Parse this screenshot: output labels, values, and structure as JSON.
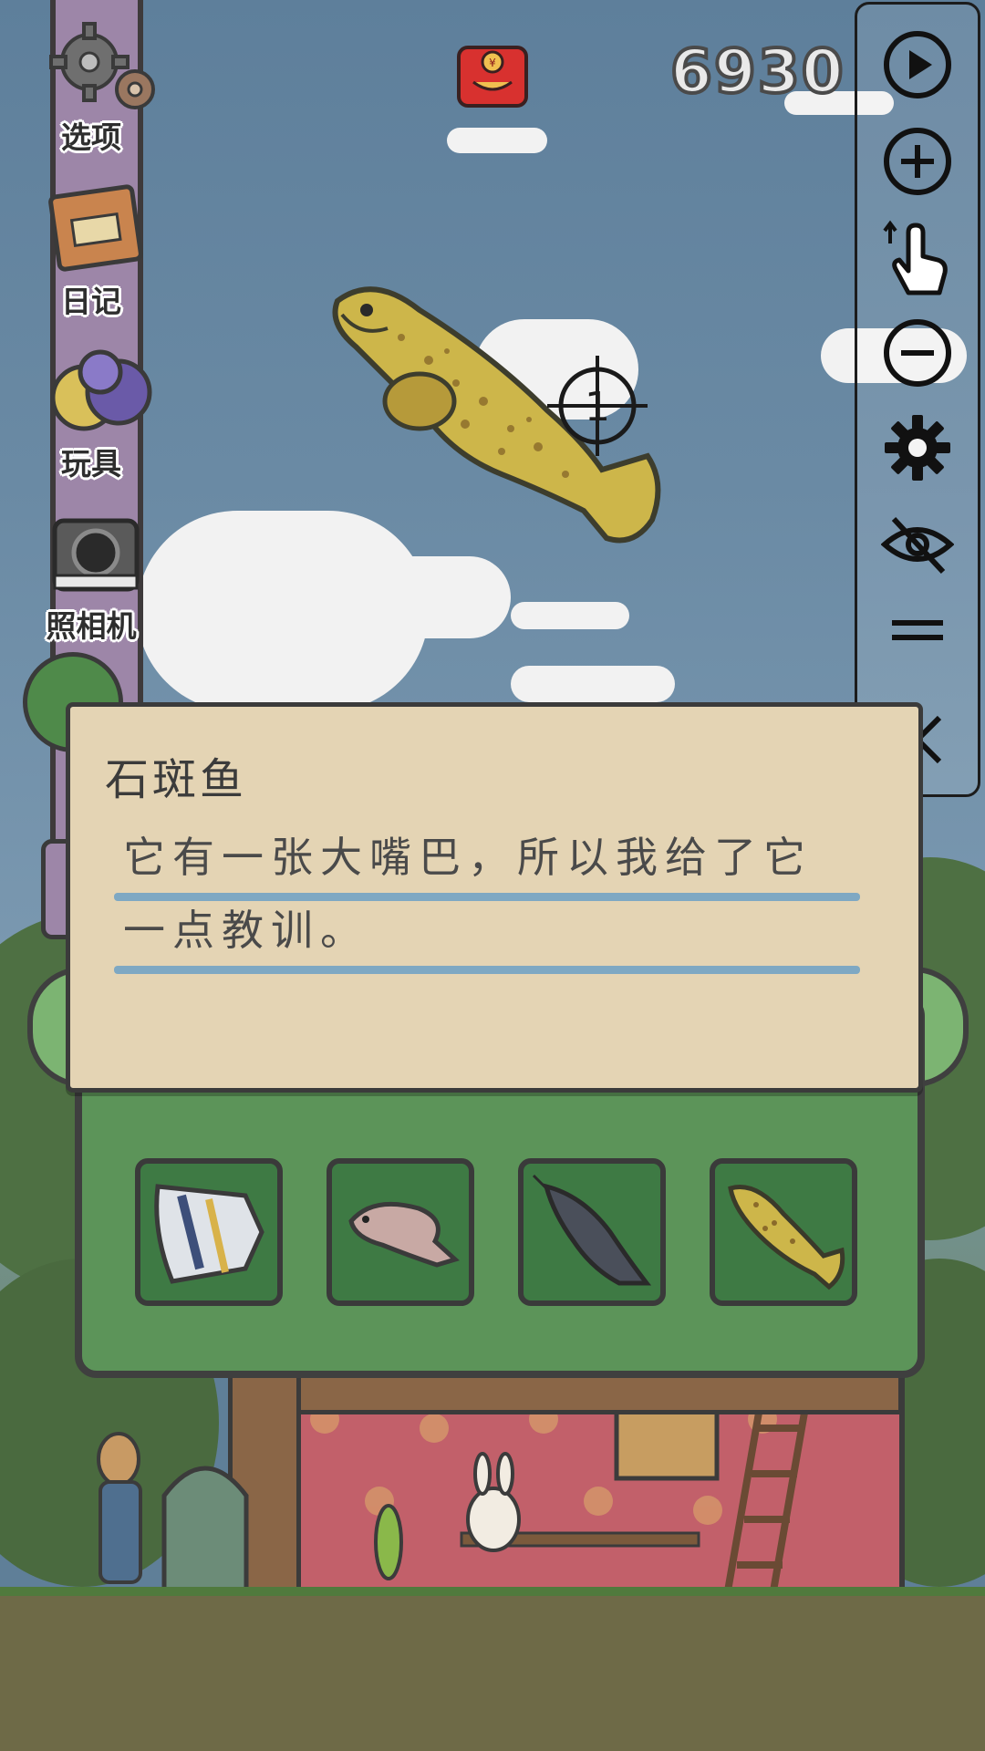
{
  "menu": {
    "items": [
      {
        "label": "选项",
        "icon": "gear-icon"
      },
      {
        "label": "日记",
        "icon": "diary-icon"
      },
      {
        "label": "玩具",
        "icon": "toys-icon"
      },
      {
        "label": "照相机",
        "icon": "camera-icon"
      }
    ]
  },
  "topbar": {
    "coins": "6930",
    "redpacket_icon": "red-envelope-icon",
    "redpacket_glyph": "¥"
  },
  "fish_target": {
    "marker": "1"
  },
  "controls": {
    "buttons": [
      {
        "name": "play-icon"
      },
      {
        "name": "zoom-in-icon"
      },
      {
        "name": "swipe-hand-icon"
      },
      {
        "name": "zoom-out-icon"
      },
      {
        "name": "settings-icon"
      },
      {
        "name": "hide-eye-icon"
      },
      {
        "name": "drag-handle-icon"
      },
      {
        "name": "close-icon"
      }
    ]
  },
  "dialog": {
    "title": "石斑鱼",
    "line1": "它有一张大嘴巴，所以我给了它",
    "line2": "一点教训。"
  },
  "collection": {
    "slots": [
      "triggerfish",
      "flounder",
      "catfish",
      "grouper"
    ]
  },
  "colors": {
    "dialog_bg": "#e4d4b4",
    "rule": "#7ea8c3",
    "panel_green": "#5c9459",
    "pole_purple": "#9d86a8"
  }
}
